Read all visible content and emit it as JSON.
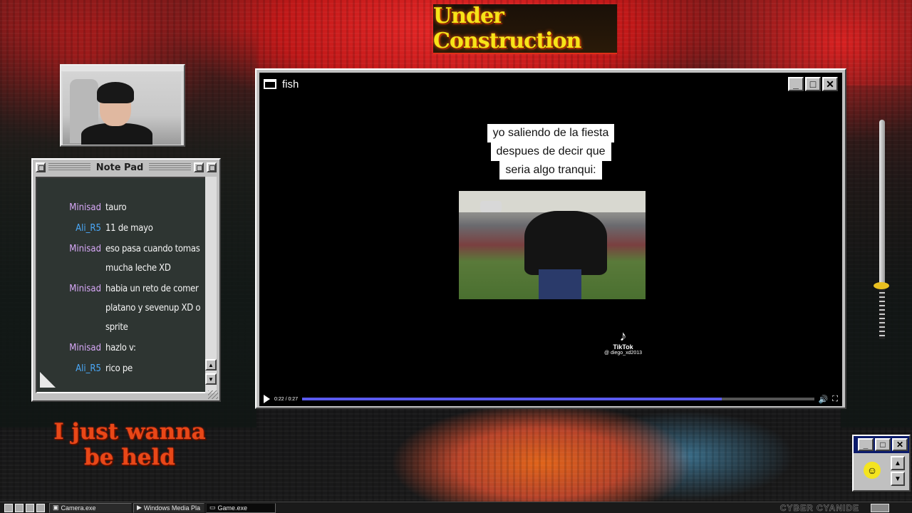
{
  "banner": {
    "text": "Under Construction"
  },
  "camera_window": {
    "title": "Camera.exe"
  },
  "notepad": {
    "title": "Note Pad",
    "messages": [
      {
        "user": "Minisad",
        "text": "tauro"
      },
      {
        "user": "Ali_R5",
        "text": "11 de mayo"
      },
      {
        "user": "Minisad",
        "text": "eso pasa cuando tomas mucha leche XD"
      },
      {
        "user": "Minisad",
        "text": "habia un reto de comer platano y sevenup XD o sprite"
      },
      {
        "user": "Minisad",
        "text": "hazlo v:"
      },
      {
        "user": "Ali_R5",
        "text": "rico pe"
      }
    ]
  },
  "overlay_text": {
    "line1": "I just wanna",
    "line2": "be held"
  },
  "video_window": {
    "title": "fish",
    "caption_lines": [
      "yo saliendo de la fiesta",
      "despues de decir que",
      "seria algo tranqui:"
    ],
    "tiktok_brand": "TikTok",
    "tiktok_handle": "@ diego_xd2013",
    "time": "0:22 / 0:27",
    "progress": 0.82
  },
  "taskbar": {
    "tasks": [
      {
        "label": "Camera.exe"
      },
      {
        "label": "Windows Media Pla"
      },
      {
        "label": "Game.exe"
      }
    ],
    "brand": "CYBER CYANIDE"
  },
  "colors": {
    "username_minisad": "#d8a8f8",
    "username_ali": "#4aa8f8",
    "progress": "#5a5af0"
  }
}
